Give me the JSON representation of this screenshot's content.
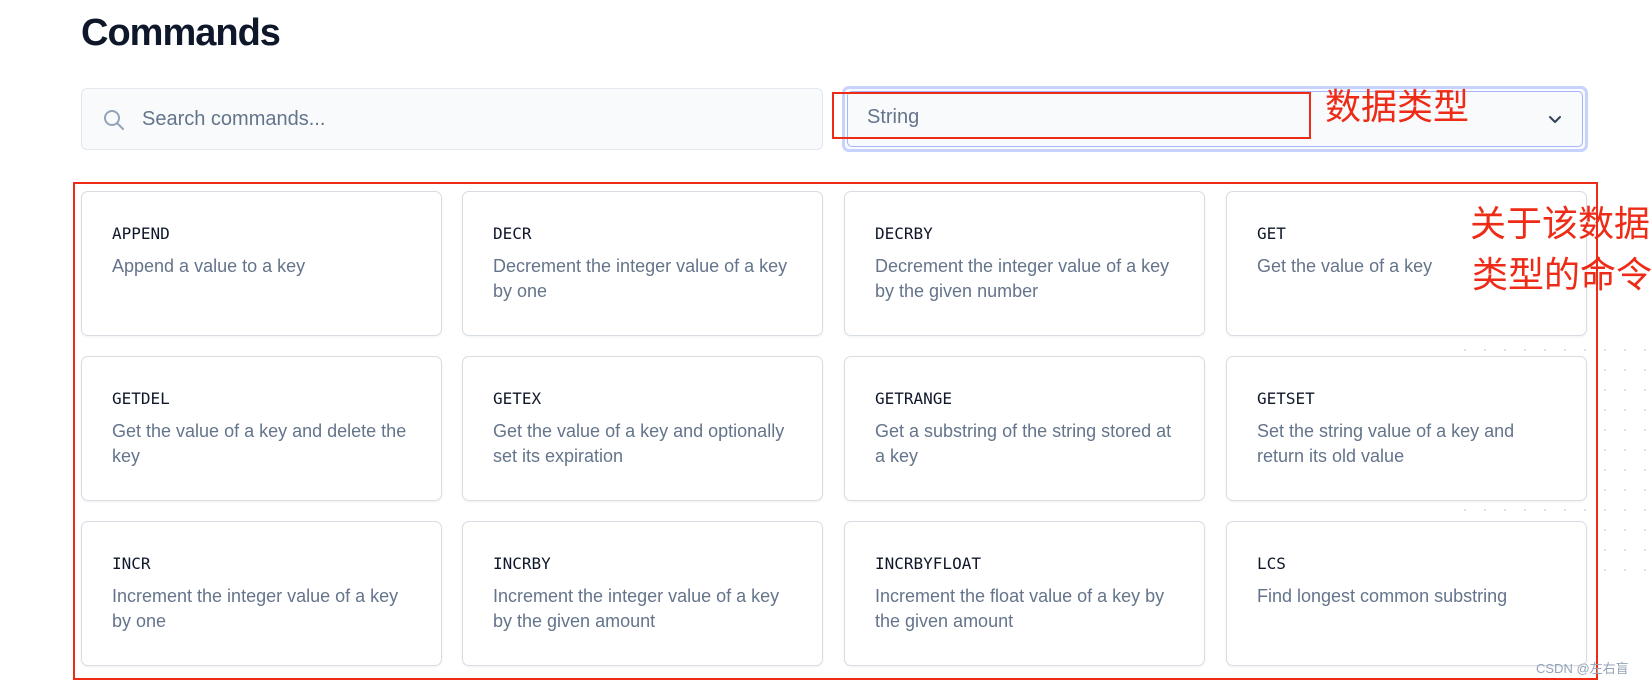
{
  "page": {
    "title": "Commands"
  },
  "search": {
    "placeholder": "Search commands..."
  },
  "filter": {
    "selected": "String"
  },
  "commands": [
    {
      "name": "APPEND",
      "desc": "Append a value to a key"
    },
    {
      "name": "DECR",
      "desc": "Decrement the integer value of a key by one"
    },
    {
      "name": "DECRBY",
      "desc": "Decrement the integer value of a key by the given number"
    },
    {
      "name": "GET",
      "desc": "Get the value of a key"
    },
    {
      "name": "GETDEL",
      "desc": "Get the value of a key and delete the key"
    },
    {
      "name": "GETEX",
      "desc": "Get the value of a key and optionally set its expiration"
    },
    {
      "name": "GETRANGE",
      "desc": "Get a substring of the string stored at a key"
    },
    {
      "name": "GETSET",
      "desc": "Set the string value of a key and return its old value"
    },
    {
      "name": "INCR",
      "desc": "Increment the integer value of a key by one"
    },
    {
      "name": "INCRBY",
      "desc": "Increment the integer value of a key by the given amount"
    },
    {
      "name": "INCRBYFLOAT",
      "desc": "Increment the float value of a key by the given amount"
    },
    {
      "name": "LCS",
      "desc": "Find longest common substring"
    }
  ],
  "annotations": {
    "data_type": "数据类型",
    "commands_line1": "关于该数据",
    "commands_line2": "类型的命令"
  },
  "watermark": "CSDN @左右盲",
  "colors": {
    "annotation": "#ee2b16",
    "select_focus": "#a5b4fc"
  }
}
